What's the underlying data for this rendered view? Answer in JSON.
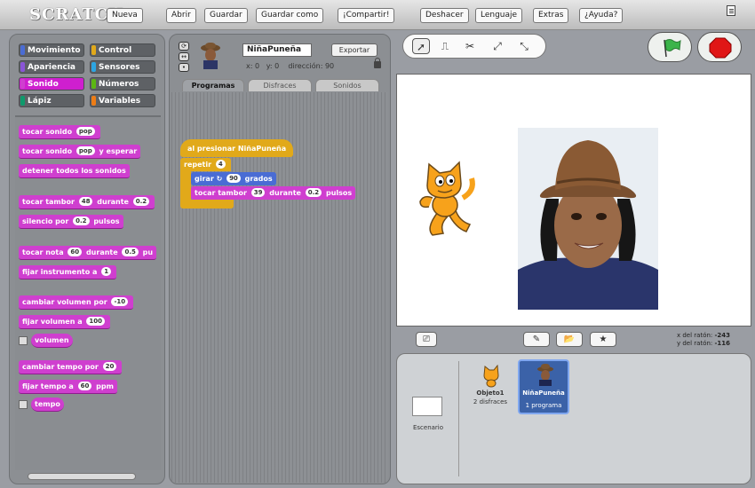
{
  "app": {
    "logo": "SCRATCH",
    "menu": [
      {
        "id": "new",
        "label": "Nueva"
      },
      {
        "id": "open",
        "label": "Abrir"
      },
      {
        "id": "save",
        "label": "Guardar"
      },
      {
        "id": "save_as",
        "label": "Guardar como"
      },
      {
        "id": "share",
        "label": "¡Compartir!"
      },
      {
        "id": "undo",
        "label": "Deshacer"
      },
      {
        "id": "language",
        "label": "Lenguaje"
      },
      {
        "id": "extras",
        "label": "Extras"
      },
      {
        "id": "help",
        "label": "¿Ayuda?"
      }
    ]
  },
  "palette": {
    "categories": [
      {
        "label": "Movimiento",
        "color": "#4a6cd4"
      },
      {
        "label": "Control",
        "color": "#e1a91a"
      },
      {
        "label": "Apariencia",
        "color": "#8a55d7"
      },
      {
        "label": "Sensores",
        "color": "#2ca5e2"
      },
      {
        "label": "Sonido",
        "color": "#cf3fcf",
        "selected": true
      },
      {
        "label": "Números",
        "color": "#5cb712"
      },
      {
        "label": "Lápiz",
        "color": "#0e9a6c"
      },
      {
        "label": "Variables",
        "color": "#ee7d16"
      }
    ],
    "blocks": {
      "play_sound": {
        "text": "tocar sonido",
        "arg": "pop"
      },
      "play_sound_wait": {
        "text": "tocar sonido",
        "arg": "pop",
        "suffix": "y esperar"
      },
      "stop_sounds": {
        "text": "detener todos los sonidos"
      },
      "play_drum": {
        "text": "tocar tambor",
        "arg": "48",
        "mid": "durante",
        "arg2": "0.2"
      },
      "rest": {
        "text": "silencio por",
        "arg": "0.2",
        "suffix": "pulsos"
      },
      "play_note": {
        "text": "tocar nota",
        "arg": "60",
        "mid": "durante",
        "arg2": "0.5",
        "suffix": "pu"
      },
      "set_instrument": {
        "text": "fijar instrumento a",
        "arg": "1"
      },
      "change_volume": {
        "text": "cambiar volumen por",
        "arg": "-10"
      },
      "set_volume": {
        "text": "fijar volumen a",
        "arg": "100"
      },
      "volume_reporter": {
        "text": "volumen"
      },
      "change_tempo": {
        "text": "cambiar tempo por",
        "arg": "20"
      },
      "set_tempo": {
        "text": "fijar tempo a",
        "arg": "60",
        "suffix": "ppm"
      },
      "tempo_reporter": {
        "text": "tempo"
      }
    }
  },
  "sprite_info": {
    "name": "NiñaPuneña",
    "export_label": "Exportar",
    "x_label": "x:",
    "x_value": "0",
    "y_label": "y:",
    "y_value": "0",
    "direction_label": "dirección:",
    "direction_value": "90"
  },
  "tabs": [
    {
      "label": "Programas",
      "active": true
    },
    {
      "label": "Disfraces"
    },
    {
      "label": "Sonidos"
    }
  ],
  "script": {
    "hat": "al presionar NiñaPuneña",
    "repeat_label": "repetir",
    "repeat_count": "4",
    "turn_label": "girar",
    "turn_value": "90",
    "turn_suffix": "grados",
    "drum_label": "tocar tambor",
    "drum_value": "39",
    "drum_mid": "durante",
    "drum_beats": "0.2",
    "drum_suffix": "pulsos"
  },
  "stage_footer": {
    "mouse_x_label": "x del ratón:",
    "mouse_x": "-243",
    "mouse_y_label": "y del ratón:",
    "mouse_y": "-116"
  },
  "library": {
    "stage_label": "Escenario",
    "sprites": [
      {
        "name": "Objeto1",
        "detail": "2 disfraces"
      },
      {
        "name": "NiñaPuneña",
        "detail": "1 programa",
        "selected": true
      }
    ]
  }
}
